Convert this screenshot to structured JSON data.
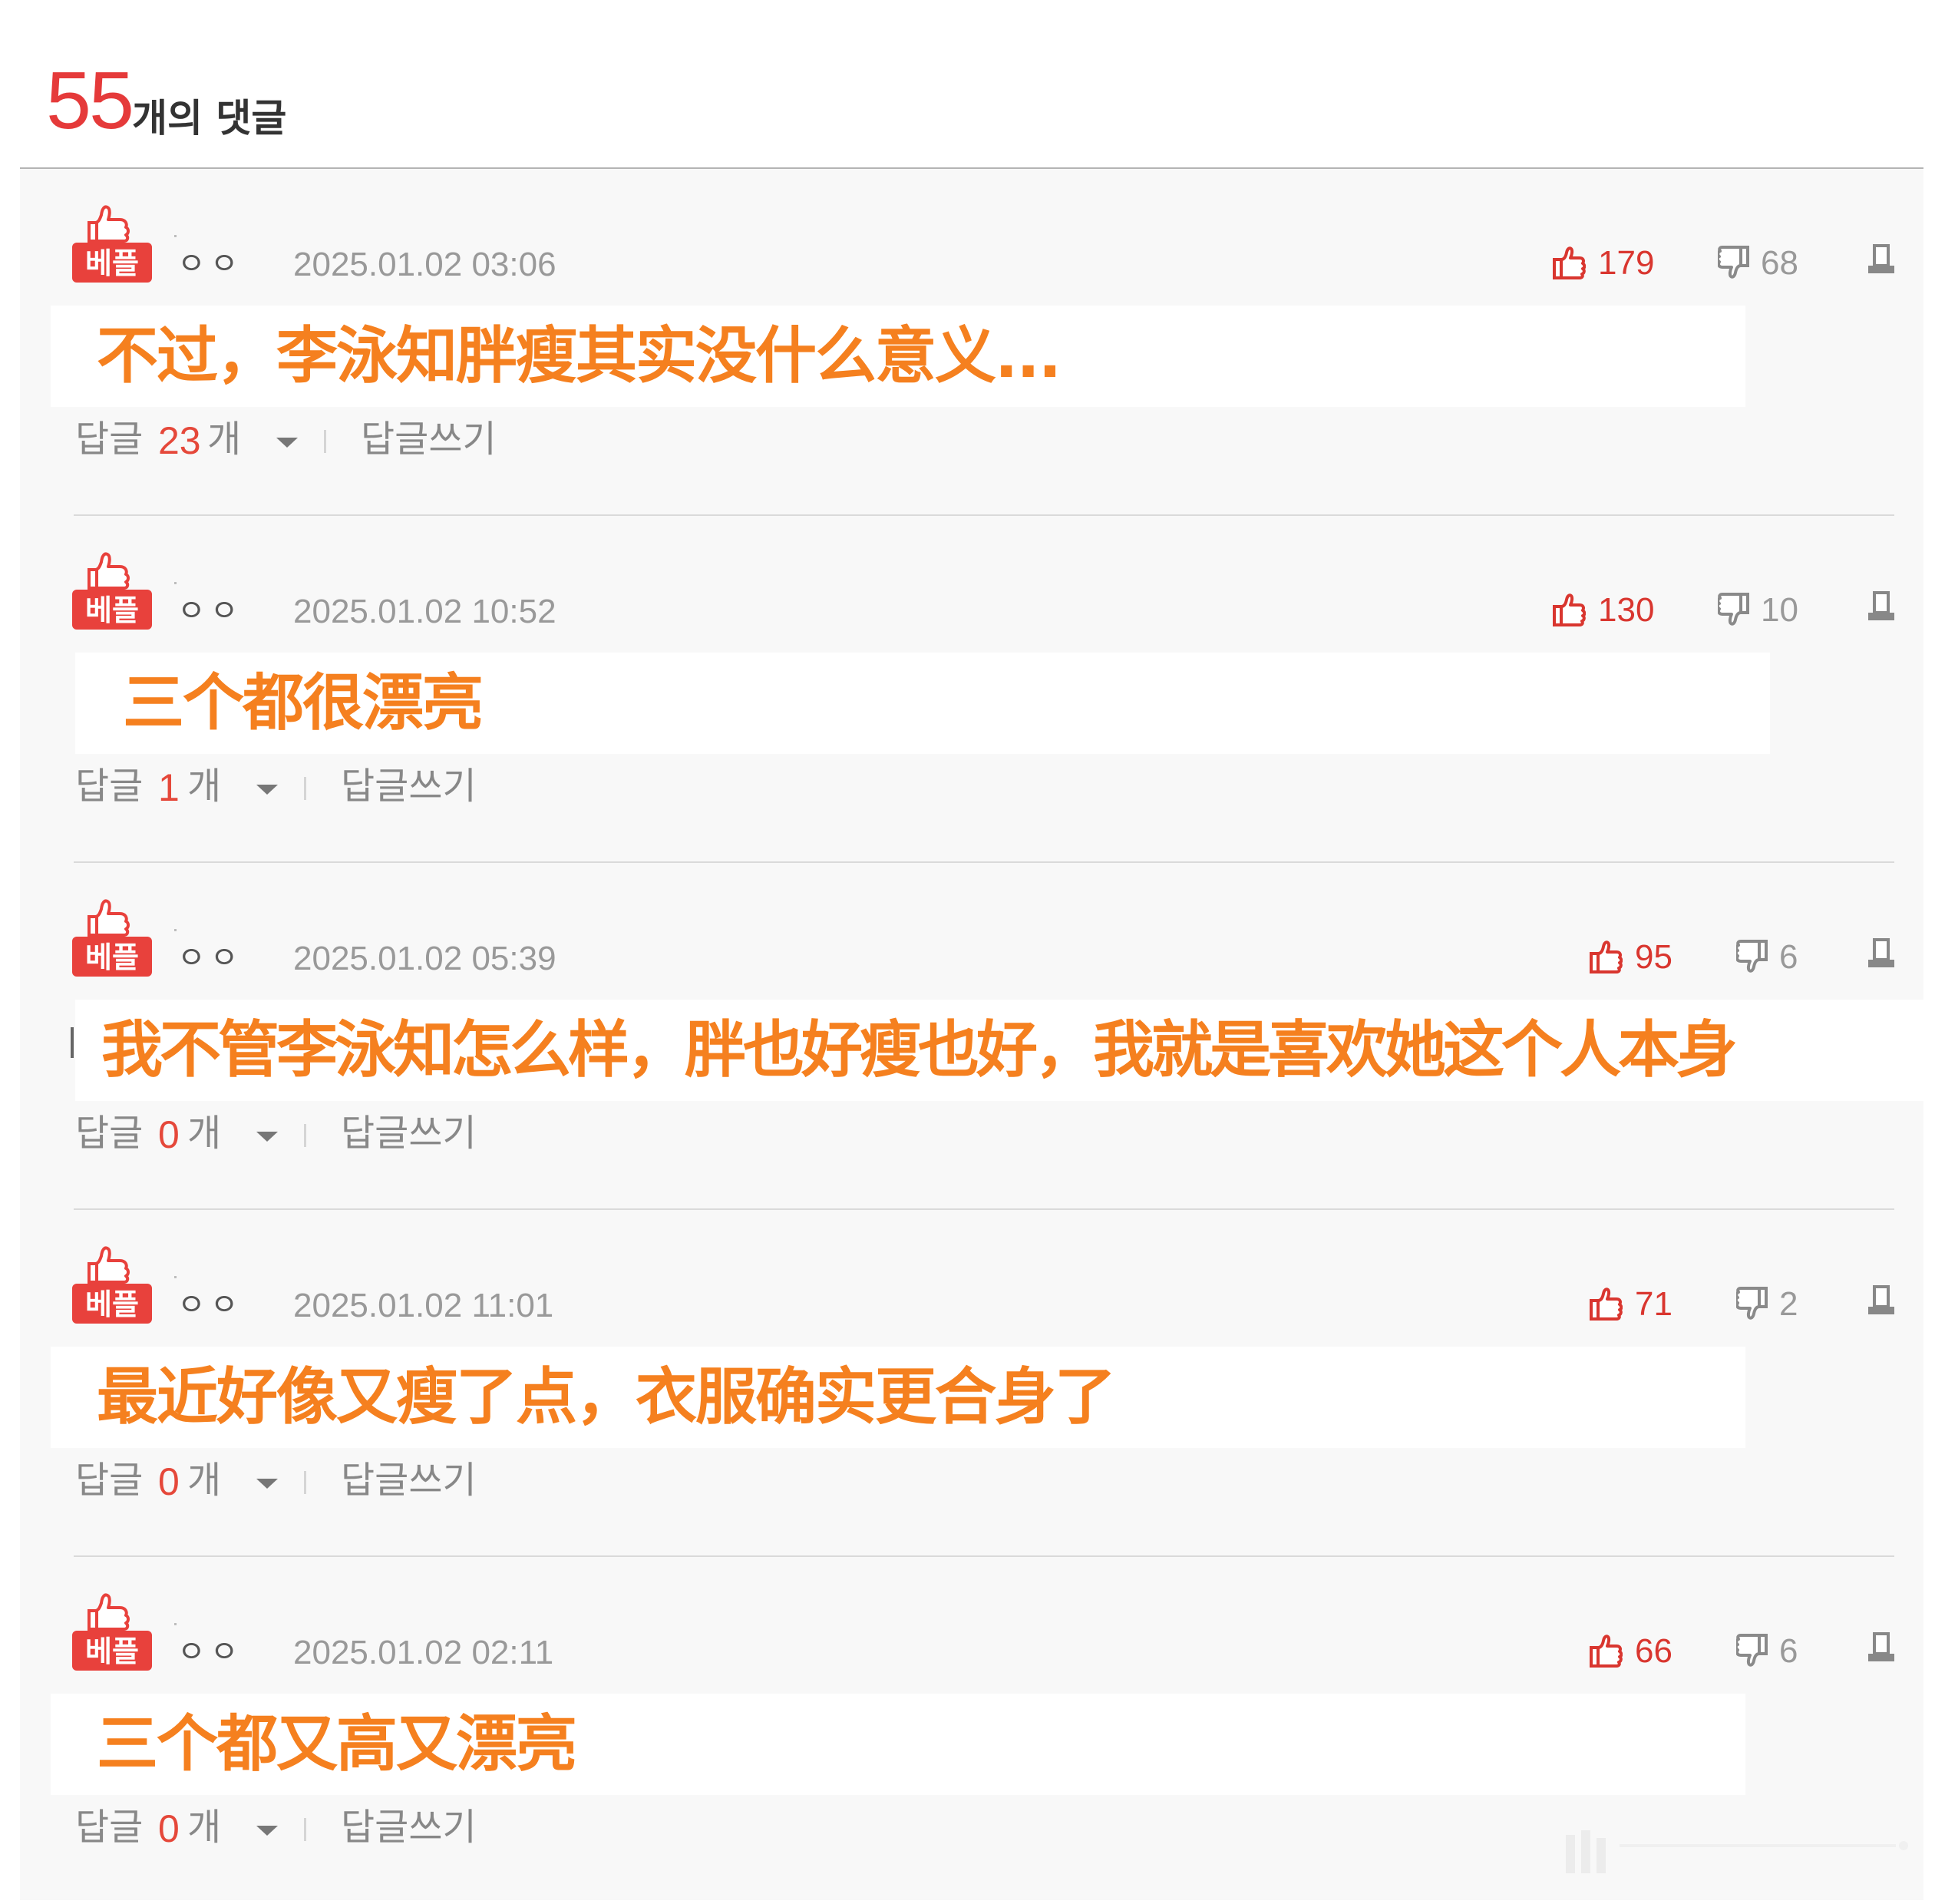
{
  "header": {
    "count": "55",
    "label": "개의 댓글"
  },
  "comments": [
    {
      "badge": "베플",
      "nickname": "ㅇㅇ",
      "date": "2025.01.02 03:06",
      "likes": "179",
      "dislikes": "68",
      "text": "不过，李泳知胖瘦其实没什么意义...",
      "reply_label": "답글",
      "reply_count": "23",
      "reply_unit": "개",
      "write_label": "답글쓰기"
    },
    {
      "badge": "베플",
      "nickname": "ㅇㅇ",
      "date": "2025.01.02 10:52",
      "likes": "130",
      "dislikes": "10",
      "text": "三个都很漂亮",
      "reply_label": "답글",
      "reply_count": "1",
      "reply_unit": "개",
      "write_label": "답글쓰기"
    },
    {
      "badge": "베플",
      "nickname": "ㅇㅇ",
      "date": "2025.01.02 05:39",
      "likes": "95",
      "dislikes": "6",
      "text": "我不管李泳知怎么样，胖也好瘦也好，我就是喜欢她这个人本身",
      "reply_label": "답글",
      "reply_count": "0",
      "reply_unit": "개",
      "write_label": "답글쓰기"
    },
    {
      "badge": "베플",
      "nickname": "ㅇㅇ",
      "date": "2025.01.02 11:01",
      "likes": "71",
      "dislikes": "2",
      "text": "最近好像又瘦了点，衣服确实更合身了",
      "reply_label": "답글",
      "reply_count": "0",
      "reply_unit": "개",
      "write_label": "답글쓰기"
    },
    {
      "badge": "베플",
      "nickname": "ㅇㅇ",
      "date": "2025.01.02 02:11",
      "likes": "66",
      "dislikes": "6",
      "text": "三个都又高又漂亮",
      "reply_label": "답글",
      "reply_count": "0",
      "reply_unit": "개",
      "write_label": "답글쓰기"
    }
  ],
  "icons": {
    "best_badge": "thumbs-up-best-icon",
    "like": "thumbs-up-icon",
    "dislike": "thumbs-down-icon",
    "report": "report-icon",
    "expand": "caret-down-icon"
  },
  "colors": {
    "accent_red": "#e53a3a",
    "best_badge": "#e8413c",
    "comment_text": "#f5801f",
    "like_red": "#d9362f",
    "muted_gray": "#999999"
  }
}
